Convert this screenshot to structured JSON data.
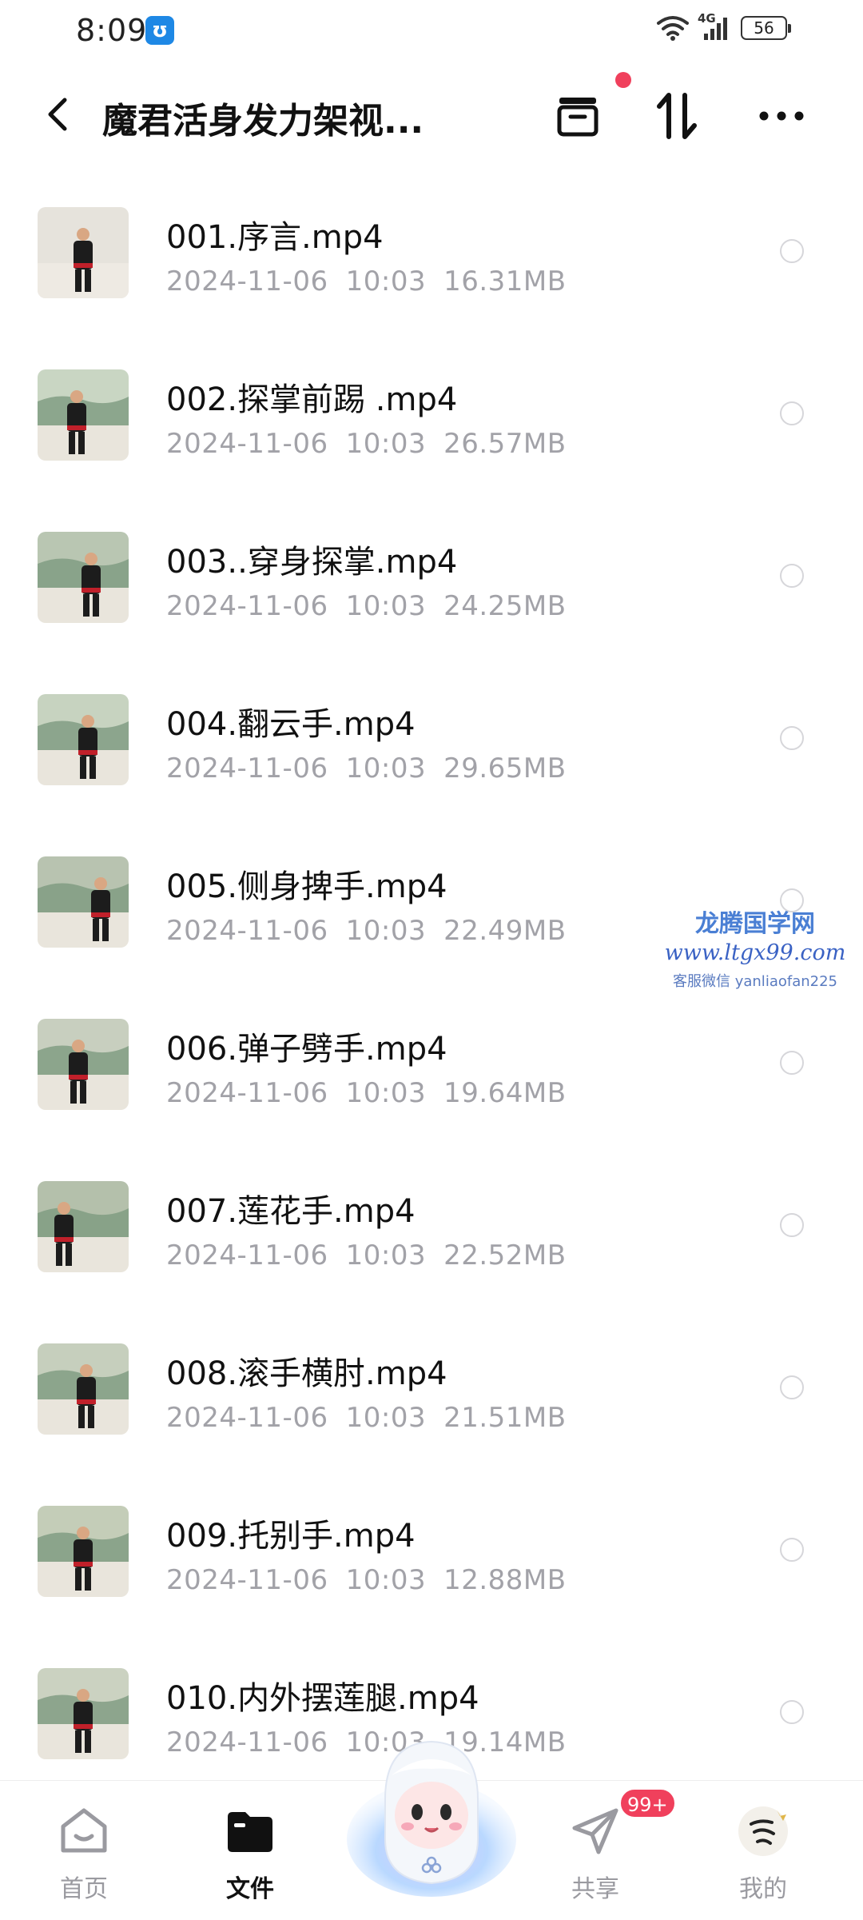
{
  "status_bar": {
    "time": "8:09",
    "app_icon_label": "ʊ",
    "network": "4G",
    "battery": "56"
  },
  "header": {
    "title": "魔君活身发力架视...",
    "icons": [
      "back-icon",
      "inbox-icon",
      "sort-icon",
      "more-icon"
    ]
  },
  "files": [
    {
      "name": "001.序言.mp4",
      "date": "2024-11-06",
      "time": "10:03",
      "size": "16.31MB"
    },
    {
      "name": "002.探掌前踢 .mp4",
      "date": "2024-11-06",
      "time": "10:03",
      "size": "26.57MB"
    },
    {
      "name": "003..穿身探掌.mp4",
      "date": "2024-11-06",
      "time": "10:03",
      "size": "24.25MB"
    },
    {
      "name": "004.翻云手.mp4",
      "date": "2024-11-06",
      "time": "10:03",
      "size": "29.65MB"
    },
    {
      "name": "005.侧身捭手.mp4",
      "date": "2024-11-06",
      "time": "10:03",
      "size": "22.49MB"
    },
    {
      "name": "006.弹子劈手.mp4",
      "date": "2024-11-06",
      "time": "10:03",
      "size": "19.64MB"
    },
    {
      "name": "007.莲花手.mp4",
      "date": "2024-11-06",
      "time": "10:03",
      "size": "22.52MB"
    },
    {
      "name": "008.滚手横肘.mp4",
      "date": "2024-11-06",
      "time": "10:03",
      "size": "21.51MB"
    },
    {
      "name": "009.托别手.mp4",
      "date": "2024-11-06",
      "time": "10:03",
      "size": "12.88MB"
    },
    {
      "name": "010.内外摆莲腿.mp4",
      "date": "2024-11-06",
      "time": "10:03",
      "size": "19.14MB"
    }
  ],
  "watermark": {
    "title": "龙腾国学网",
    "url": "www.ltgx99.com",
    "contact": "客服微信 yanliaofan225"
  },
  "bottom_nav": {
    "items": [
      {
        "label": "首页",
        "icon": "home-icon"
      },
      {
        "label": "文件",
        "icon": "folder-icon"
      },
      {
        "label": "共享",
        "icon": "share-icon"
      },
      {
        "label": "我的",
        "icon": "avatar"
      }
    ],
    "share_badge": "99+"
  },
  "colors": {
    "accent_red": "#f0405c",
    "meta_gray": "#a2a2a8"
  }
}
